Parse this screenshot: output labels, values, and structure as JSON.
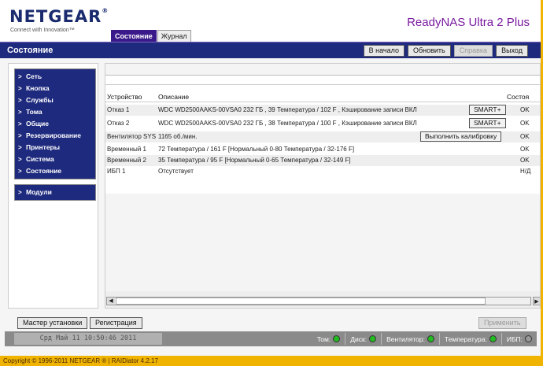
{
  "header": {
    "logo": "NETGEAR",
    "logo_tm": "®",
    "tagline": "Connect with Innovation™",
    "product": "ReadyNAS Ultra 2 Plus",
    "tabs": [
      {
        "label": "Состояние",
        "active": true
      },
      {
        "label": "Журнал",
        "active": false
      }
    ]
  },
  "titlebar": {
    "title": "Состояние",
    "buttons": {
      "home": "В начало",
      "refresh": "Обновить",
      "help": "Справка",
      "logout": "Выход"
    }
  },
  "sidebar": {
    "items": [
      "Сеть",
      "Кнопка",
      "Службы",
      "Тома",
      "Общие",
      "Резервирование",
      "Принтеры",
      "Система",
      "Состояние"
    ],
    "modules": "Модули"
  },
  "table": {
    "headers": {
      "device": "Устройство",
      "description": "Описание",
      "status": "Состоя"
    },
    "rows": [
      {
        "device": "Отказ 1",
        "description": "WDC WD2500AAKS-00VSA0 232 ГБ , 39 Температура / 102 F , Кэширование записи ВКЛ",
        "button": "SMART+",
        "status": "OK"
      },
      {
        "device": "Отказ 2",
        "description": "WDC WD2500AAKS-00VSA0 232 ГБ , 38 Температура / 100 F , Кэширование записи ВКЛ",
        "button": "SMART+",
        "status": "OK"
      },
      {
        "device": "Вентилятор SYS",
        "description": "1165 об./мин.",
        "button": "Выполнить калибровку",
        "status": "OK"
      },
      {
        "device": "Временный 1",
        "description": "72 Температура / 161 F [Нормальный 0-80 Температура / 32-176 F]",
        "status": "OK"
      },
      {
        "device": "Временный 2",
        "description": "35 Температура / 95 F [Нормальный 0-65 Температура / 32-149 F]",
        "status": "OK"
      },
      {
        "device": "ИБП 1",
        "description": "Отсутствует",
        "status": "Н/Д"
      }
    ]
  },
  "bottom": {
    "wizard": "Мастер установки",
    "register": "Регистрация",
    "apply": "Применить"
  },
  "statusbar": {
    "datetime": "Срд Май 11  10:50:46 2011",
    "indicators": [
      {
        "label": "Том:",
        "color": "#22bb22"
      },
      {
        "label": "Диск:",
        "color": "#22bb22"
      },
      {
        "label": "Вентилятор:",
        "color": "#22bb22"
      },
      {
        "label": "Температура:",
        "color": "#22bb22"
      },
      {
        "label": "ИБП:",
        "color": "#999999"
      }
    ]
  },
  "footer": {
    "copyright": "Copyright © 1996-2011 NETGEAR ® | RAIDiator 4.2.17"
  }
}
